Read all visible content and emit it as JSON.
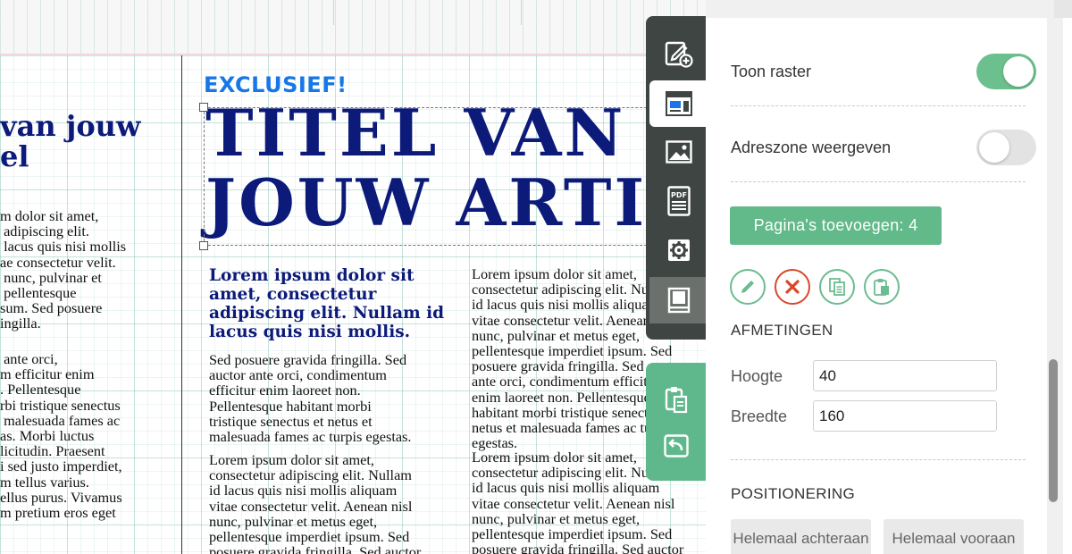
{
  "canvas": {
    "left_column": {
      "heading": "van jouw\nel",
      "body_1": "m dolor sit amet,\n adipiscing elit.\n lacus quis nisi mollis\nae consectetur velit.\n nunc, pulvinar et\n pellentesque\nsum. Sed posuere\ningilla.",
      "body_2": " ante orci,\nm efficitur enim\n. Pellentesque\nrbi tristique senectus\n malesuada fames ac\nas. Morbi luctus\nlicitudin. Praesent\ni sed justo imperdiet,\nm tellus varius.\nellus purus. Vivamus\nm pretium eros eget"
    },
    "article": {
      "kicker": "EXCLUSIEF!",
      "title": "TITEL VAN\nJOUW ARTIKEL",
      "lead": "Lorem ipsum dolor sit\namet, consectetur\nadipiscing elit. Nullam id\nlacus quis nisi mollis.",
      "body_1": "Sed posuere gravida fringilla. Sed\nauctor ante orci, condimentum\nefficitur enim laoreet non.\nPellentesque habitant morbi\ntristique senectus et netus et\nmalesuada fames ac turpis egestas.",
      "body_2": "Lorem ipsum dolor sit amet,\nconsectetur adipiscing elit. Nullam\nid lacus quis nisi mollis aliquam\nvitae consectetur velit. Aenean nisl\nnunc, pulvinar et metus eget,\npellentesque imperdiet ipsum. Sed\nposuere gravida fringilla. Sed auctor",
      "right_col_1": "Lorem ipsum dolor sit amet,\nconsectetur adipiscing elit. Nullam\nid lacus quis nisi mollis aliquam\nvitae consectetur velit. Aenean nisl\nnunc, pulvinar et metus eget,\npellentesque imperdiet ipsum. Sed\nposuere gravida fringilla. Sed auctor\nante orci, condimentum efficitur\nenim laoreet non. Pellentesque\nhabitant morbi tristique senectus et\nnetus et malesuada fames ac turpis\negestas.",
      "right_col_2": "Lorem ipsum dolor sit amet,\nconsectetur adipiscing elit. Nullam\nid lacus quis nisi mollis aliquam\nvitae consectetur velit. Aenean nisl\nnunc, pulvinar et metus eget,\npellentesque imperdiet ipsum. Sed\nposuere gravida fringilla. Sed auctor"
    }
  },
  "toolbar": {
    "tools": [
      {
        "icon": "edit-add-icon"
      },
      {
        "icon": "layout-icon",
        "active": true
      },
      {
        "icon": "image-icon"
      },
      {
        "icon": "pdf-icon"
      },
      {
        "icon": "gear-icon"
      },
      {
        "icon": "book-icon"
      }
    ],
    "actions": [
      {
        "icon": "clipboard-icon"
      },
      {
        "icon": "undo-icon"
      }
    ]
  },
  "panel": {
    "show_grid": {
      "label": "Toon raster",
      "on": true
    },
    "show_address": {
      "label": "Adreszone weergeven",
      "on": false
    },
    "add_pages_label": "Pagina's toevoegen: 4",
    "page_actions": [
      "pencil-icon",
      "close-icon",
      "copy-icon",
      "paste-icon"
    ],
    "dimensions_title": "AFMETINGEN",
    "height_label": "Hoogte",
    "height_value": "40",
    "width_label": "Breedte",
    "width_value": "160",
    "positioning_title": "POSITIONERING",
    "pos_back_label": "Helemaal achteraan",
    "pos_front_label": "Helemaal vooraan"
  },
  "colors": {
    "accent_green": "#62b98a",
    "title_navy": "#0c1a7a",
    "kicker_blue": "#1877e6",
    "toolbar_dark": "#3f4542",
    "danger_red": "#d9472b"
  }
}
